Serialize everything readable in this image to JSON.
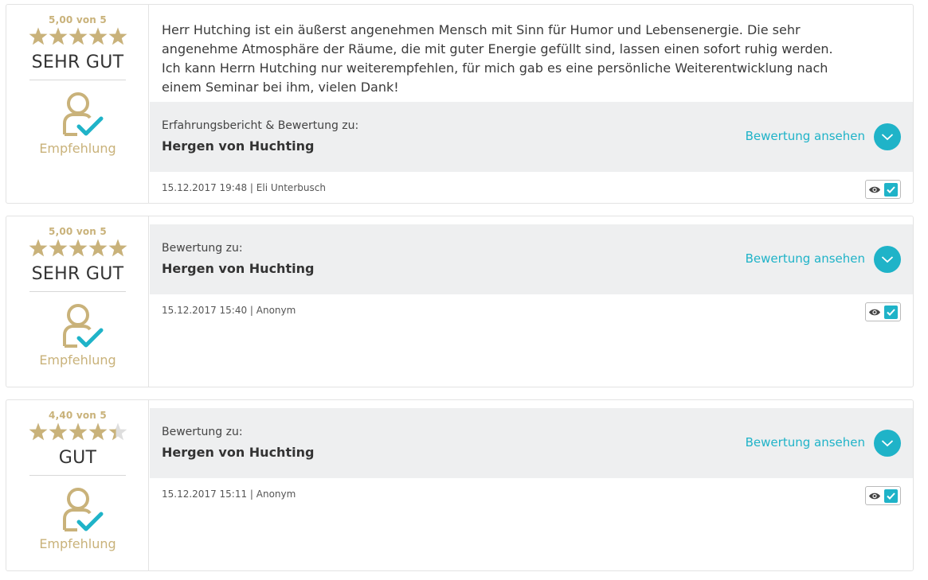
{
  "reviews": [
    {
      "score_text": "5,00 von 5",
      "stars": 5,
      "grade": "SEHR GUT",
      "recommendation": "Empfehlung",
      "text": "Herr Hutching ist ein äußerst angenehmen Mensch mit Sinn für Humor und Lebensenergie. Die sehr angenehme Atmosphäre der Räume, die mit guter Energie gefüllt sind, lassen einen sofort ruhig werden. Ich kann Herrn Hutching nur weiterempfehlen, für mich gab es eine persönliche Weiterentwicklung nach einem Seminar bei ihm, vielen Dank!",
      "label": "Erfahrungsbericht & Bewertung zu:",
      "subject": "Hergen von Huchting",
      "link": "Bewertung ansehen",
      "meta": "15.12.2017 19:48 | Eli Unterbusch"
    },
    {
      "score_text": "5,00 von 5",
      "stars": 5,
      "grade": "SEHR GUT",
      "recommendation": "Empfehlung",
      "label": "Bewertung zu:",
      "subject": "Hergen von Huchting",
      "link": "Bewertung ansehen",
      "meta": "15.12.2017 15:40 | Anonym"
    },
    {
      "score_text": "4,40 von 5",
      "stars": 4.4,
      "grade": "GUT",
      "recommendation": "Empfehlung",
      "label": "Bewertung zu:",
      "subject": "Hergen von Huchting",
      "link": "Bewertung ansehen",
      "meta": "15.12.2017 15:11 | Anonym"
    }
  ],
  "colors": {
    "gold": "#c9b27a",
    "accent": "#1fb3c8",
    "panel_gray": "#eeeff0",
    "star_empty": "#dedede"
  },
  "icons": {
    "star": "star-icon",
    "recommendation": "person-check-icon",
    "expand": "chevron-down-icon",
    "visibility": "eye-icon",
    "checkbox": "checkbox-checked-icon"
  }
}
